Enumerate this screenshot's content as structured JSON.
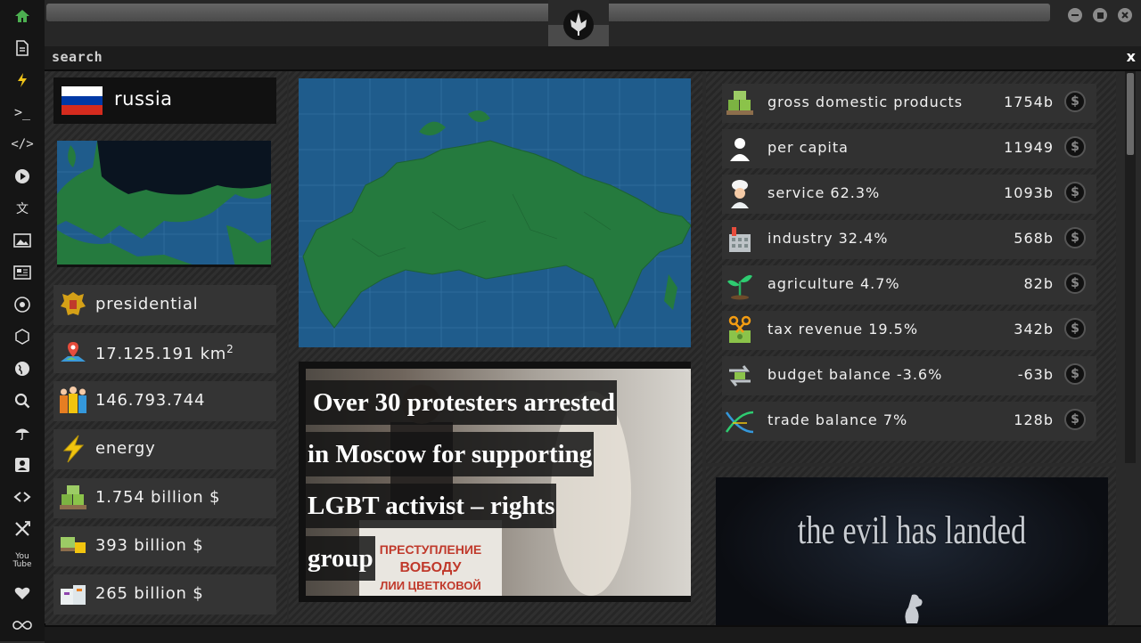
{
  "search": {
    "label": "search",
    "close": "x"
  },
  "sidebar": {
    "icons": [
      "home-icon",
      "document-icon",
      "lightning-icon",
      "terminal-icon",
      "code-icon",
      "play-icon",
      "translate-icon",
      "image-icon",
      "news-icon",
      "aperture-icon",
      "hexagon-icon",
      "globe-icon",
      "search-icon",
      "umbrella-icon",
      "contact-icon",
      "link-icon",
      "shuffle-icon",
      "youtube-icon",
      "heart-icon",
      "infinity-icon"
    ],
    "youtube_text": "You\nTube"
  },
  "country": {
    "name": "russia",
    "flag_colors": [
      "#ffffff",
      "#0039a6",
      "#d52b1e"
    ]
  },
  "info_rows": [
    {
      "icon": "coat-of-arms-icon",
      "text": "presidential"
    },
    {
      "icon": "map-pin-icon",
      "text": "17.125.191 km",
      "sup": "2"
    },
    {
      "icon": "people-icon",
      "text": "146.793.744"
    },
    {
      "icon": "energy-icon",
      "text": "energy"
    },
    {
      "icon": "cash-pallet-icon",
      "text": "1.754 billion $"
    },
    {
      "icon": "forklift-cash-icon",
      "text": "393 billion $"
    },
    {
      "icon": "package-icon",
      "text": "265 billion $"
    }
  ],
  "news": {
    "lines": [
      "Over 30 protesters arrested",
      "in Moscow for supporting",
      "LGBT activist – rights",
      "group"
    ]
  },
  "stats": [
    {
      "icon": "cash-pallet-icon",
      "label": "gross domestic products",
      "value": "1754b"
    },
    {
      "icon": "person-icon",
      "label": "per capita",
      "value": "11949"
    },
    {
      "icon": "chef-icon",
      "label": "service 62.3%",
      "value": "1093b"
    },
    {
      "icon": "factory-icon",
      "label": "industry 32.4%",
      "value": "568b"
    },
    {
      "icon": "plant-icon",
      "label": "agriculture 4.7%",
      "value": "82b"
    },
    {
      "icon": "scissors-money-icon",
      "label": "tax revenue 19.5%",
      "value": "342b"
    },
    {
      "icon": "exchange-arrows-icon",
      "label": "budget balance -3.6%",
      "value": "-63b"
    },
    {
      "icon": "trade-lines-icon",
      "label": "trade balance 7%",
      "value": "128b"
    }
  ],
  "dollar_symbol": "$",
  "movie": {
    "title": "the evil has landed"
  },
  "colors": {
    "map_ocean": "#1f5c8c",
    "map_land": "#257a3e",
    "map_highlight": "#0a1420"
  }
}
